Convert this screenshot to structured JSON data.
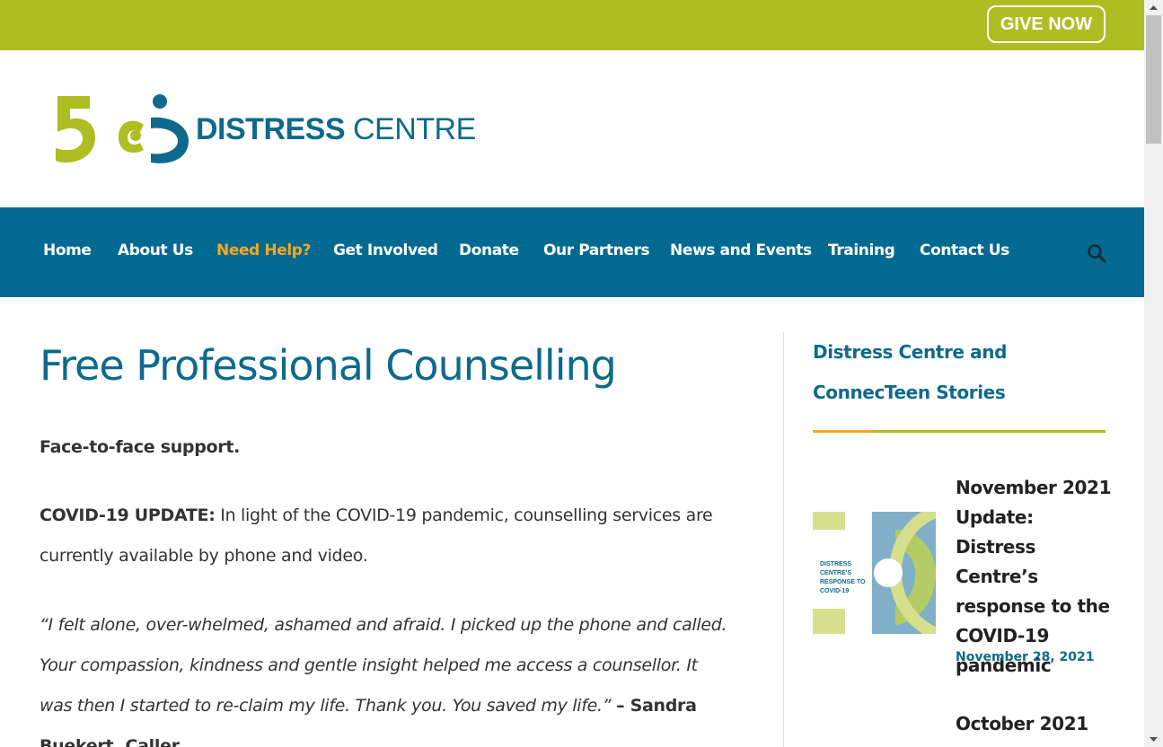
{
  "topbar": {
    "give_label": "GIVE NOW"
  },
  "logo": {
    "brand_bold": "DISTRESS",
    "brand_light": "CENTRE",
    "number": "50"
  },
  "nav": {
    "items": [
      {
        "label": "Home"
      },
      {
        "label": "About Us"
      },
      {
        "label": "Need Help?"
      },
      {
        "label": "Get Involved"
      },
      {
        "label": "Donate"
      },
      {
        "label": "Our Partners"
      },
      {
        "label": "News and Events"
      },
      {
        "label": "Training"
      },
      {
        "label": "Contact Us"
      }
    ],
    "active_index": 2,
    "search_icon": "search-icon"
  },
  "main": {
    "title": "Free Professional Counselling",
    "lead": "Face-to-face support.",
    "covid_label": "COVID-19 UPDATE:",
    "covid_text": " In light of the COVID-19 pandemic, counselling services are currently available by phone and video.",
    "quote": "“I felt alone, over-whelmed, ashamed and afraid. I picked up the phone and called. Your compassion, kindness and gentle insight helped me access a counsellor. It was then I started to re-claim my life. Thank you. You saved my life.” ",
    "quote_author": "– Sandra Buekert, Caller"
  },
  "sidebar": {
    "title": "Distress Centre and ConnecTeen Stories",
    "posts": [
      {
        "title": "November 2021 Update: Distress Centre’s response to the COVID-19 pandemic",
        "date": "November 28, 2021",
        "thumb_text": "DISTRESS CENTRE'S RESPONSE TO COVID-19"
      },
      {
        "title": "October 2021"
      }
    ]
  },
  "colors": {
    "lime": "#aebd22",
    "teal": "#026a90",
    "heading": "#0e6a8c",
    "accent": "#f5a623"
  }
}
